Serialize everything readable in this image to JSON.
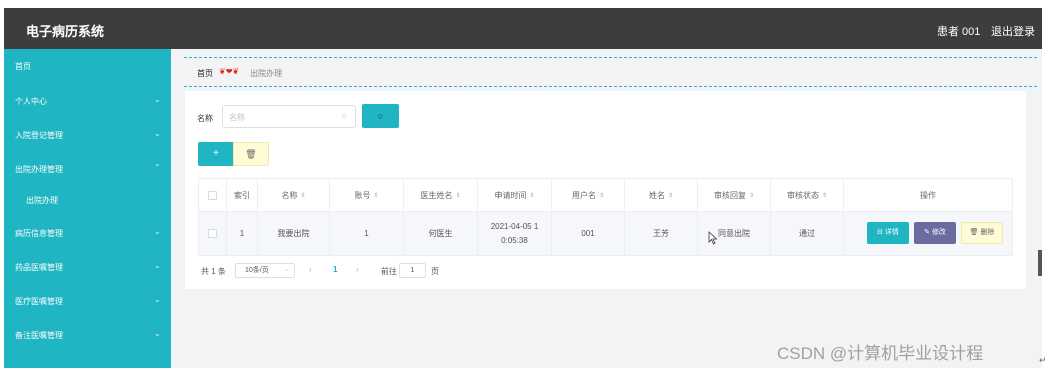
{
  "app": {
    "title": "电子病历系统",
    "user": "患者 001",
    "logout": "退出登录"
  },
  "sidebar": {
    "items": [
      {
        "label": "首页",
        "chevron": ""
      },
      {
        "label": "个人中心",
        "chevron": "⌄"
      },
      {
        "label": "入院登记管理",
        "chevron": "⌄"
      },
      {
        "label": "出院办理管理",
        "chevron": "⌃"
      },
      {
        "label": "出院办理",
        "chevron": ""
      },
      {
        "label": "病历信息管理",
        "chevron": "⌄"
      },
      {
        "label": "药品医嘱管理",
        "chevron": "⌄"
      },
      {
        "label": "医疗医嘱管理",
        "chevron": "⌄"
      },
      {
        "label": "备注医嘱管理",
        "chevron": "⌄"
      }
    ]
  },
  "breadcrumb": {
    "home": "首页",
    "decor": "❦❤❦",
    "current": "出院办理"
  },
  "search": {
    "label": "名称",
    "placeholder": "名称",
    "icon": "search-icon"
  },
  "toolbar": {
    "add": "+",
    "delete": "🗑"
  },
  "table": {
    "headers": [
      "",
      "索引",
      "名称",
      "账号",
      "医生姓名",
      "申请时间",
      "用户名",
      "姓名",
      "审核回复",
      "审核状态",
      "操作"
    ],
    "rows": [
      {
        "index": "1",
        "name": "我要出院",
        "account": "1",
        "doctor": "何医生",
        "time": "2021-04-05 1\n0:05:38",
        "username": "001",
        "fullname": "王芳",
        "reply": "同意出院",
        "status": "通过"
      }
    ],
    "actions": {
      "detail": "⊟ 详情",
      "edit": "✎ 修改",
      "delete": "🗑 删除"
    }
  },
  "pagination": {
    "total": "共 1 条",
    "page_size": "10条/页",
    "prev": "‹",
    "current_page": "1",
    "next": "›",
    "goto_label": "前往",
    "goto_value": "1",
    "page_unit": "页"
  },
  "watermark": "CSDN @计算机毕业设计程",
  "colors": {
    "accent": "#1fb5c2",
    "topbar": "#3d3d3d",
    "edit": "#6b6ba0",
    "delete": "#fffbd6"
  }
}
